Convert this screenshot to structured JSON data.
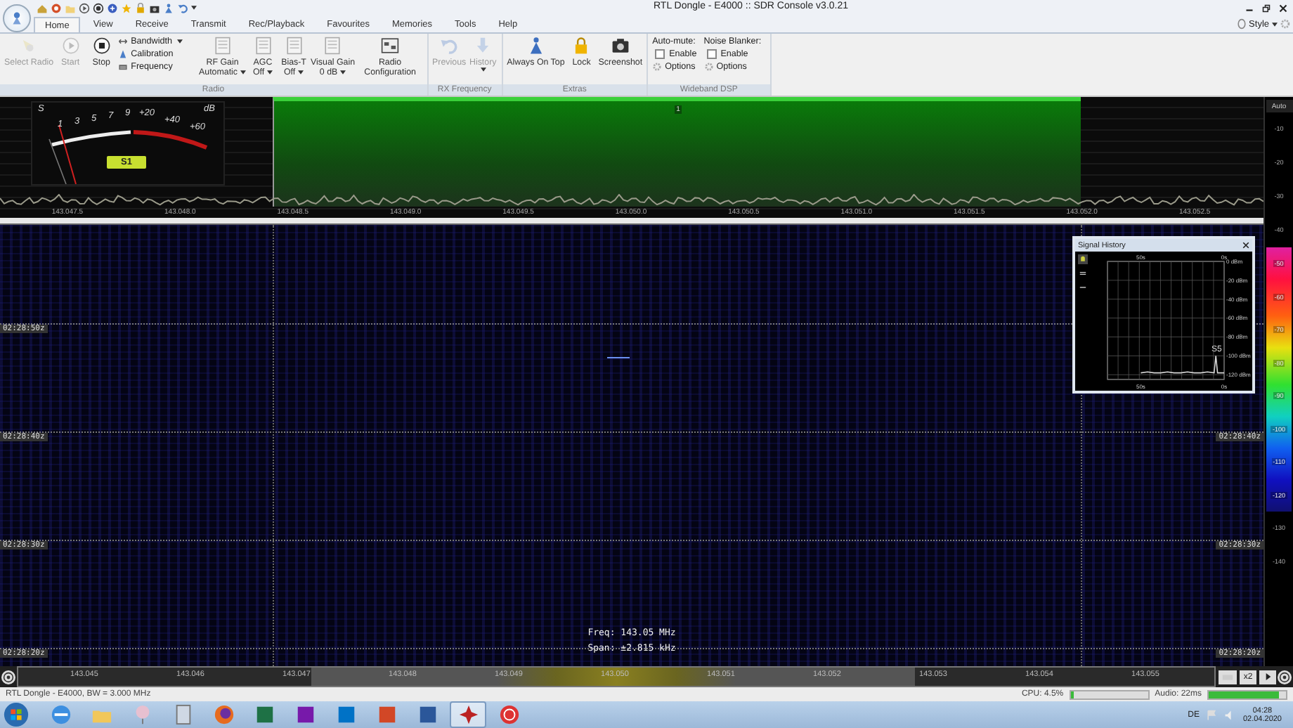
{
  "window": {
    "title": "RTL Dongle - E4000 :: SDR Console v3.0.21"
  },
  "tabs": [
    {
      "label": "Home",
      "selected": true
    },
    {
      "label": "View",
      "selected": false
    },
    {
      "label": "Receive",
      "selected": false
    },
    {
      "label": "Transmit",
      "selected": false
    },
    {
      "label": "Rec/Playback",
      "selected": false
    },
    {
      "label": "Favourites",
      "selected": false
    },
    {
      "label": "Memories",
      "selected": false
    },
    {
      "label": "Tools",
      "selected": false
    },
    {
      "label": "Help",
      "selected": false
    }
  ],
  "style_menu": {
    "label": "Style"
  },
  "ribbon": {
    "groups": [
      {
        "title": "Radio",
        "items": [
          {
            "kind": "large",
            "label": "Select Radio",
            "disabled": true
          },
          {
            "kind": "large",
            "label": "Start",
            "disabled": true
          },
          {
            "kind": "large",
            "label": "Stop",
            "disabled": false
          },
          {
            "kind": "stack",
            "entries": [
              {
                "label": "Bandwidth",
                "dropdown": true
              },
              {
                "label": "Calibration",
                "dropdown": false
              },
              {
                "label": "Frequency",
                "dropdown": false
              }
            ]
          },
          {
            "kind": "dropdown",
            "label": "RF Gain",
            "value": "Automatic",
            "disabled": false
          },
          {
            "kind": "dropdown",
            "label": "AGC",
            "value": "Off",
            "disabled": false
          },
          {
            "kind": "dropdown",
            "label": "Bias-T",
            "value": "Off",
            "disabled": false
          },
          {
            "kind": "dropdown",
            "label": "Visual Gain",
            "value": "0 dB",
            "disabled": false
          },
          {
            "kind": "large",
            "label": "Radio Configuration",
            "disabled": false
          }
        ]
      },
      {
        "title": "RX Frequency",
        "items": [
          {
            "kind": "large",
            "label": "Previous",
            "disabled": true
          },
          {
            "kind": "dropdown",
            "label": "History",
            "disabled": true
          }
        ]
      },
      {
        "title": "Extras",
        "items": [
          {
            "kind": "large",
            "label": "Always On Top",
            "disabled": false
          },
          {
            "kind": "large",
            "label": "Lock",
            "disabled": false
          },
          {
            "kind": "large",
            "label": "Screenshot",
            "disabled": false
          }
        ]
      },
      {
        "title": "Wideband DSP",
        "items": [
          {
            "kind": "options",
            "heading": "Auto-mute:",
            "check_label": "Enable",
            "checked": false,
            "options_label": "Options"
          },
          {
            "kind": "options",
            "heading": "Noise Blanker:",
            "check_label": "Enable",
            "checked": false,
            "options_label": "Options"
          }
        ]
      }
    ]
  },
  "spectrum": {
    "smeter": {
      "s_label": "S",
      "scale": [
        "1",
        "3",
        "5",
        "7",
        "9"
      ],
      "plus_scale": [
        "+20",
        "+40",
        "+60"
      ],
      "unit": "dB",
      "reading": "S1"
    },
    "passband": {
      "label": "1"
    },
    "freq_axis": [
      "143.047.5",
      "143.048.0",
      "143.048.5",
      "143.049.0",
      "143.049.5",
      "143.050.0",
      "143.050.5",
      "143.051.0",
      "143.051.5",
      "143.052.0",
      "143.052.5"
    ]
  },
  "side_scale": {
    "auto_label": "Auto",
    "labels": [
      "-10",
      "-20",
      "-30",
      "-40"
    ],
    "color_labels": [
      "-50",
      "-60",
      "-70",
      "-80",
      "-90",
      "-100",
      "-110",
      "-120"
    ],
    "lower_labels": [
      "-130",
      "-140"
    ]
  },
  "waterfall": {
    "times_left": [
      "02:28:50z",
      "02:28:40z",
      "02:28:30z",
      "02:28:20z"
    ],
    "times_right": [
      "02:28:40z",
      "02:28:30z",
      "02:28:20z"
    ],
    "freq_text": "Freq: 143.05 MHz",
    "span_text": "Span: ±2.815 kHz",
    "signal_history": {
      "title": "Signal History",
      "reading": "S5",
      "chart_data": {
        "type": "line",
        "grid": true,
        "xlim": [
          -70,
          0
        ],
        "ylim": [
          -125,
          0
        ],
        "xticks": [
          {
            "value": -50,
            "label": "50s"
          },
          {
            "value": 0,
            "label": "0s"
          }
        ],
        "yticks": [
          {
            "value": 0,
            "label": "0 dBm"
          },
          {
            "value": -20,
            "label": "-20 dBm"
          },
          {
            "value": -40,
            "label": "-40 dBm"
          },
          {
            "value": -60,
            "label": "-60 dBm"
          },
          {
            "value": -80,
            "label": "-80 dBm"
          },
          {
            "value": -100,
            "label": "-100 dBm"
          },
          {
            "value": -120,
            "label": "-120 dBm"
          }
        ],
        "x": [
          -50,
          -46,
          -42,
          -38,
          -34,
          -30,
          -26,
          -22,
          -18,
          -14,
          -10,
          -6,
          -5,
          -4,
          -2,
          0
        ],
        "series": [
          {
            "color": "#d8d8d8",
            "values": [
              -118,
              -117,
              -118,
              -118,
              -117,
              -118,
              -118,
              -117,
              -118,
              -118,
              -117,
              -118,
              -100,
              -118,
              -118,
              -118
            ]
          }
        ]
      }
    }
  },
  "bottom_scale": {
    "labels": [
      "143.045",
      "143.046",
      "143.047",
      "143.048",
      "143.049",
      "143.050",
      "143.051",
      "143.052",
      "143.053",
      "143.054",
      "143.055"
    ],
    "zoom_label": "x2"
  },
  "status_bar": {
    "text": "RTL Dongle - E4000, BW = 3.000 MHz",
    "cpu": {
      "label": "CPU: 4.5%",
      "level": 0.045
    },
    "audio": {
      "label": "Audio: 22ms",
      "level": 0.9
    }
  },
  "taskbar": {
    "apps": [
      {
        "selected": false
      },
      {
        "selected": false
      },
      {
        "selected": false
      },
      {
        "selected": false
      },
      {
        "selected": false
      },
      {
        "selected": false
      },
      {
        "selected": false
      },
      {
        "selected": false
      },
      {
        "selected": false
      },
      {
        "selected": false
      },
      {
        "selected": true
      },
      {
        "selected": false
      }
    ],
    "language": "DE",
    "time": "04:28",
    "date": "02.04.2020"
  }
}
